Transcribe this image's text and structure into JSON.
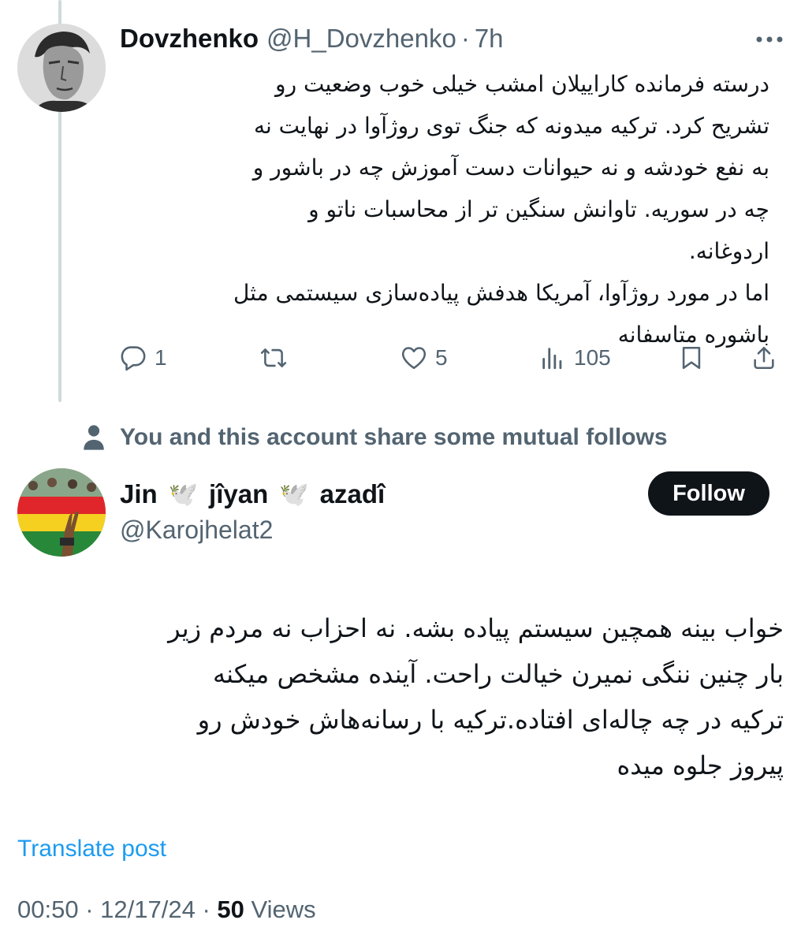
{
  "parent_tweet": {
    "author_name": "Dovzhenko",
    "handle": "@H_Dovzhenko",
    "separator": "·",
    "time": "7h",
    "text": "درسته فرمانده کاراییلان امشب خیلی خوب وضعیت رو\nتشریح کرد. ترکیه میدونه که جنگ توی روژآوا در نهایت نه\nبه نفع خودشه و نه حیوانات دست آموزش چه در باشور و\nچه در سوریه. تاوانش سنگین تر از محاسبات ناتو و\nاردوغانه.\nاما در مورد روژآوا، آمریکا هدفش پیاده‌سازی سیستمی مثل\nباشوره متاسفانه",
    "replies": "1",
    "likes": "5",
    "views": "105"
  },
  "social_context": {
    "text": "You and this account share some mutual follows"
  },
  "reply_tweet": {
    "name_part1": "Jin",
    "name_part2": "jîyan",
    "name_part3": "azadî",
    "dove_emoji": "🕊️",
    "handle": "@Karojhelat2",
    "follow_label": "Follow",
    "text": "خواب بینه همچین سیستم پیاده بشه. نه احزاب نه مردم زیر\nبار چنین ننگی نمیرن خیالت راحت. آینده مشخص میکنه\nترکیه در چه چاله‌ای افتاده.ترکیه با رسانه‌هاش خودش رو\nپیروز جلوه میده",
    "translate_label": "Translate post",
    "time": "00:50",
    "separator": "·",
    "date": "12/17/24",
    "views_count": "50",
    "views_label": "Views"
  },
  "colors": {
    "text_primary": "#0f1419",
    "text_secondary": "#536471",
    "link": "#1d9bf0",
    "thread_line": "#cfd9de",
    "follow_bg": "#0f1419"
  },
  "icons": [
    "more-icon",
    "reply-icon",
    "repost-icon",
    "like-icon",
    "views-icon",
    "bookmark-icon",
    "share-icon",
    "person-icon"
  ]
}
